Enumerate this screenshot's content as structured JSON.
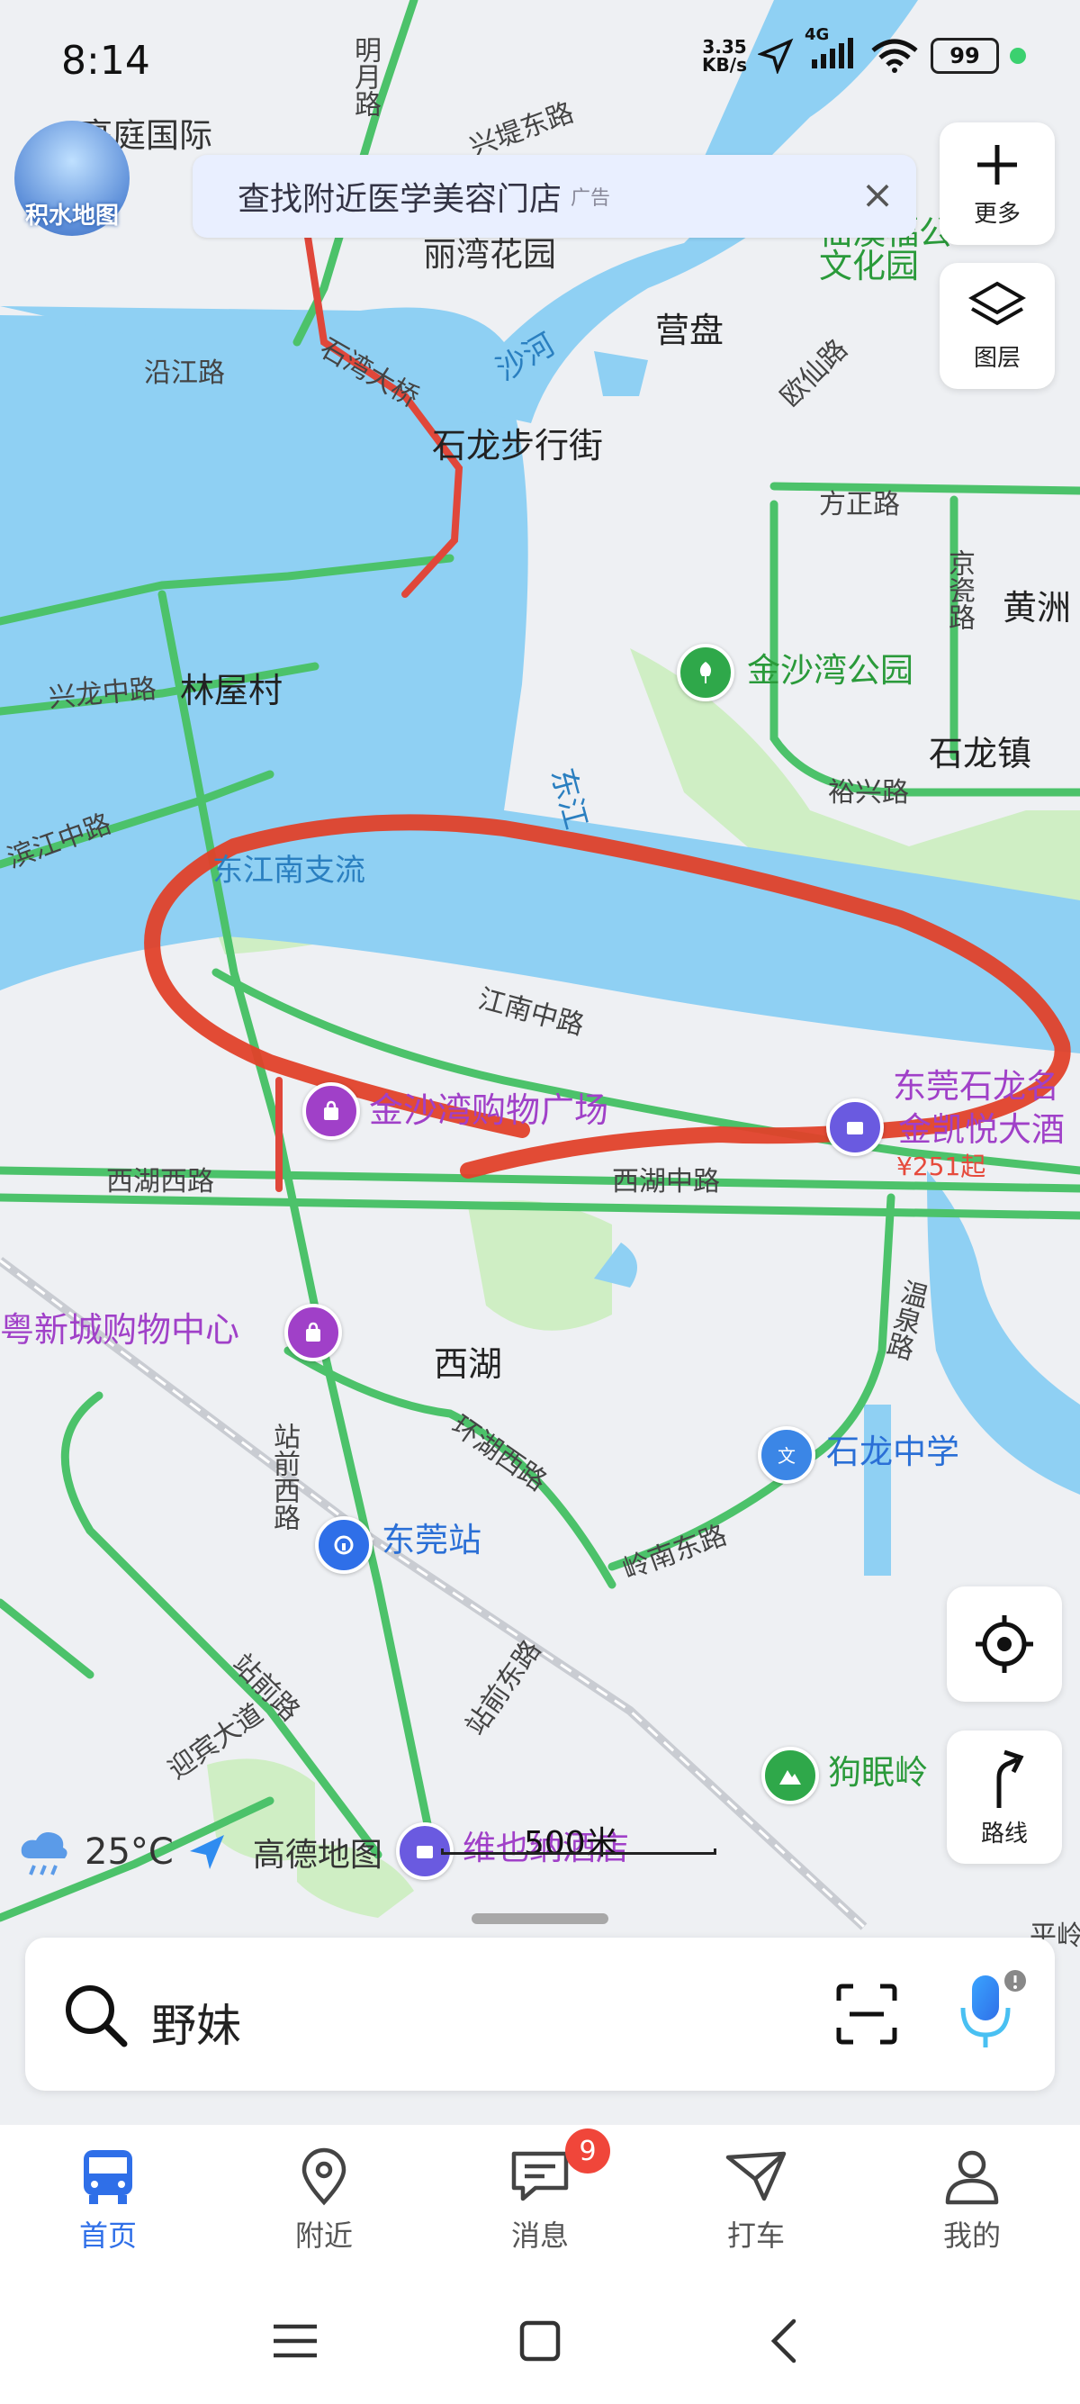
{
  "status_bar": {
    "time": "8:14",
    "net_speed_value": "3.35",
    "net_speed_unit": "KB/s",
    "network": "4G",
    "battery": "99"
  },
  "logo_text": "积水地图",
  "ad_banner": {
    "text": "查找附近医学美容门店",
    "ad_tag": "广告"
  },
  "map_controls": {
    "more_label": "更多",
    "layers_label": "图层",
    "route_label": "路线"
  },
  "map_labels": {
    "tingting": "亭庭国际",
    "mingyue_rd": "明月路",
    "xingti_rd": "兴堤东路",
    "liwan": "丽湾花园",
    "gongyuan": "仙溪福公文化园",
    "yanjiang_rd": "沿江路",
    "shiwan_bridge": "石湾大桥",
    "sha_river": "沙河",
    "yingpan": "营盘",
    "ouxian_rd": "欧仙路",
    "shilong_walk": "石龙步行街",
    "fangzheng_rd": "方正路",
    "jingzi_rd": "京瓷路",
    "huangzhou": "黄洲",
    "xinglong_rd": "兴龙中路",
    "linwu": "林屋村",
    "jinsha_park": "金沙湾公园",
    "shilong_town": "石龙镇",
    "yuxing_rd": "裕兴路",
    "binjiang_rd": "滨江中路",
    "dongjiang": "东江",
    "jiangnan_branch": "东江南支流",
    "jiangnan_rd": "江南中路",
    "jinsha_mall": "金沙湾购物广场",
    "hotel_1": "东莞石龙名",
    "hotel_2": "金凯悦大酒",
    "hotel_price": "¥251起",
    "xihu_west_rd": "西湖西路",
    "xihu_mid_rd": "西湖中路",
    "yuexin_mall": "粤新城购物中心",
    "xihu": "西湖",
    "wenquan_rd": "温泉路",
    "zhanxi_rd": "站前西路",
    "huanhu_rd": "环湖西路",
    "shilong_school": "石龙中学",
    "dongguan_station": "东莞站",
    "lingnan_rd": "岭南东路",
    "zhanqian_rd": "站前路",
    "zhanqian_east": "站前东路",
    "yingbin_rd": "迎宾大道",
    "goumian": "狗眠岭",
    "weiye_hotel": "维也纳酒店",
    "ping": "平岭"
  },
  "weather": {
    "temp": "25°C",
    "brand": "高德地图"
  },
  "scale_label": "500米",
  "search": {
    "query": "野妹"
  },
  "tabs": [
    {
      "label": "首页",
      "icon": "bus-icon"
    },
    {
      "label": "附近",
      "icon": "location-pin-icon"
    },
    {
      "label": "消息",
      "icon": "message-icon",
      "badge": "9"
    },
    {
      "label": "打车",
      "icon": "taxi-icon"
    },
    {
      "label": "我的",
      "icon": "profile-icon"
    }
  ],
  "colors": {
    "accent": "#2f6fe8",
    "road_green": "#4cc26a",
    "water": "#8fd0f3",
    "annotation_red": "#e0412a",
    "poi_purple": "#a040c8"
  }
}
